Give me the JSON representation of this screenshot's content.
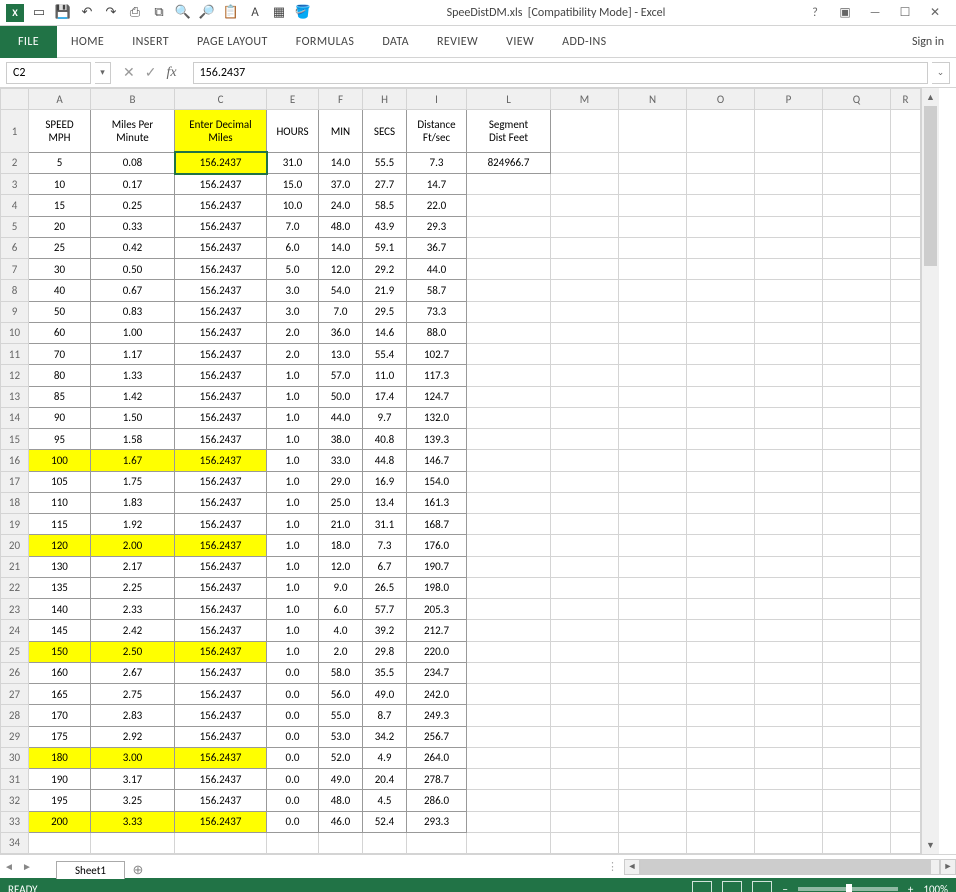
{
  "title": "SpeeDistDM.xls  [Compatibility Mode] - Excel",
  "signin": "Sign in",
  "ribbon": [
    "FILE",
    "HOME",
    "INSERT",
    "PAGE LAYOUT",
    "FORMULAS",
    "DATA",
    "REVIEW",
    "VIEW",
    "ADD-INS"
  ],
  "namebox": "C2",
  "formula": "156.2437",
  "columns": [
    "A",
    "B",
    "C",
    "E",
    "F",
    "H",
    "I",
    "L",
    "M",
    "N",
    "O",
    "P",
    "Q",
    "R"
  ],
  "headers": {
    "A1": "SPEED",
    "A2": "MPH",
    "B1": "Miles Per",
    "B2": "Minute",
    "C1": "Enter Decimal",
    "C2": "Miles",
    "E1": "",
    "E2": "HOURS",
    "F1": "",
    "F2": "MIN",
    "H1": "",
    "H2": "SECS",
    "I1": "Distance",
    "I2": "Ft/sec",
    "L1": "Segment",
    "L2": "Dist Feet"
  },
  "L2": "824966.7",
  "rows": [
    {
      "r": 2,
      "A": "5",
      "B": "0.08",
      "C": "156.2437",
      "E": "31.0",
      "F": "14.0",
      "H": "55.5",
      "I": "7.3",
      "hl": false,
      "sel": true
    },
    {
      "r": 3,
      "A": "10",
      "B": "0.17",
      "C": "156.2437",
      "E": "15.0",
      "F": "37.0",
      "H": "27.7",
      "I": "14.7",
      "hl": false
    },
    {
      "r": 4,
      "A": "15",
      "B": "0.25",
      "C": "156.2437",
      "E": "10.0",
      "F": "24.0",
      "H": "58.5",
      "I": "22.0",
      "hl": false
    },
    {
      "r": 5,
      "A": "20",
      "B": "0.33",
      "C": "156.2437",
      "E": "7.0",
      "F": "48.0",
      "H": "43.9",
      "I": "29.3",
      "hl": false
    },
    {
      "r": 6,
      "A": "25",
      "B": "0.42",
      "C": "156.2437",
      "E": "6.0",
      "F": "14.0",
      "H": "59.1",
      "I": "36.7",
      "hl": false
    },
    {
      "r": 7,
      "A": "30",
      "B": "0.50",
      "C": "156.2437",
      "E": "5.0",
      "F": "12.0",
      "H": "29.2",
      "I": "44.0",
      "hl": false
    },
    {
      "r": 8,
      "A": "40",
      "B": "0.67",
      "C": "156.2437",
      "E": "3.0",
      "F": "54.0",
      "H": "21.9",
      "I": "58.7",
      "hl": false
    },
    {
      "r": 9,
      "A": "50",
      "B": "0.83",
      "C": "156.2437",
      "E": "3.0",
      "F": "7.0",
      "H": "29.5",
      "I": "73.3",
      "hl": false
    },
    {
      "r": 10,
      "A": "60",
      "B": "1.00",
      "C": "156.2437",
      "E": "2.0",
      "F": "36.0",
      "H": "14.6",
      "I": "88.0",
      "hl": false
    },
    {
      "r": 11,
      "A": "70",
      "B": "1.17",
      "C": "156.2437",
      "E": "2.0",
      "F": "13.0",
      "H": "55.4",
      "I": "102.7",
      "hl": false
    },
    {
      "r": 12,
      "A": "80",
      "B": "1.33",
      "C": "156.2437",
      "E": "1.0",
      "F": "57.0",
      "H": "11.0",
      "I": "117.3",
      "hl": false
    },
    {
      "r": 13,
      "A": "85",
      "B": "1.42",
      "C": "156.2437",
      "E": "1.0",
      "F": "50.0",
      "H": "17.4",
      "I": "124.7",
      "hl": false
    },
    {
      "r": 14,
      "A": "90",
      "B": "1.50",
      "C": "156.2437",
      "E": "1.0",
      "F": "44.0",
      "H": "9.7",
      "I": "132.0",
      "hl": false
    },
    {
      "r": 15,
      "A": "95",
      "B": "1.58",
      "C": "156.2437",
      "E": "1.0",
      "F": "38.0",
      "H": "40.8",
      "I": "139.3",
      "hl": false
    },
    {
      "r": 16,
      "A": "100",
      "B": "1.67",
      "C": "156.2437",
      "E": "1.0",
      "F": "33.0",
      "H": "44.8",
      "I": "146.7",
      "hl": true
    },
    {
      "r": 17,
      "A": "105",
      "B": "1.75",
      "C": "156.2437",
      "E": "1.0",
      "F": "29.0",
      "H": "16.9",
      "I": "154.0",
      "hl": false
    },
    {
      "r": 18,
      "A": "110",
      "B": "1.83",
      "C": "156.2437",
      "E": "1.0",
      "F": "25.0",
      "H": "13.4",
      "I": "161.3",
      "hl": false
    },
    {
      "r": 19,
      "A": "115",
      "B": "1.92",
      "C": "156.2437",
      "E": "1.0",
      "F": "21.0",
      "H": "31.1",
      "I": "168.7",
      "hl": false
    },
    {
      "r": 20,
      "A": "120",
      "B": "2.00",
      "C": "156.2437",
      "E": "1.0",
      "F": "18.0",
      "H": "7.3",
      "I": "176.0",
      "hl": true
    },
    {
      "r": 21,
      "A": "130",
      "B": "2.17",
      "C": "156.2437",
      "E": "1.0",
      "F": "12.0",
      "H": "6.7",
      "I": "190.7",
      "hl": false
    },
    {
      "r": 22,
      "A": "135",
      "B": "2.25",
      "C": "156.2437",
      "E": "1.0",
      "F": "9.0",
      "H": "26.5",
      "I": "198.0",
      "hl": false
    },
    {
      "r": 23,
      "A": "140",
      "B": "2.33",
      "C": "156.2437",
      "E": "1.0",
      "F": "6.0",
      "H": "57.7",
      "I": "205.3",
      "hl": false
    },
    {
      "r": 24,
      "A": "145",
      "B": "2.42",
      "C": "156.2437",
      "E": "1.0",
      "F": "4.0",
      "H": "39.2",
      "I": "212.7",
      "hl": false
    },
    {
      "r": 25,
      "A": "150",
      "B": "2.50",
      "C": "156.2437",
      "E": "1.0",
      "F": "2.0",
      "H": "29.8",
      "I": "220.0",
      "hl": true
    },
    {
      "r": 26,
      "A": "160",
      "B": "2.67",
      "C": "156.2437",
      "E": "0.0",
      "F": "58.0",
      "H": "35.5",
      "I": "234.7",
      "hl": false
    },
    {
      "r": 27,
      "A": "165",
      "B": "2.75",
      "C": "156.2437",
      "E": "0.0",
      "F": "56.0",
      "H": "49.0",
      "I": "242.0",
      "hl": false
    },
    {
      "r": 28,
      "A": "170",
      "B": "2.83",
      "C": "156.2437",
      "E": "0.0",
      "F": "55.0",
      "H": "8.7",
      "I": "249.3",
      "hl": false
    },
    {
      "r": 29,
      "A": "175",
      "B": "2.92",
      "C": "156.2437",
      "E": "0.0",
      "F": "53.0",
      "H": "34.2",
      "I": "256.7",
      "hl": false
    },
    {
      "r": 30,
      "A": "180",
      "B": "3.00",
      "C": "156.2437",
      "E": "0.0",
      "F": "52.0",
      "H": "4.9",
      "I": "264.0",
      "hl": true
    },
    {
      "r": 31,
      "A": "190",
      "B": "3.17",
      "C": "156.2437",
      "E": "0.0",
      "F": "49.0",
      "H": "20.4",
      "I": "278.7",
      "hl": false
    },
    {
      "r": 32,
      "A": "195",
      "B": "3.25",
      "C": "156.2437",
      "E": "0.0",
      "F": "48.0",
      "H": "4.5",
      "I": "286.0",
      "hl": false
    },
    {
      "r": 33,
      "A": "200",
      "B": "3.33",
      "C": "156.2437",
      "E": "0.0",
      "F": "46.0",
      "H": "52.4",
      "I": "293.3",
      "hl": true
    }
  ],
  "sheet": "Sheet1",
  "status": "READY",
  "zoom": "100%"
}
